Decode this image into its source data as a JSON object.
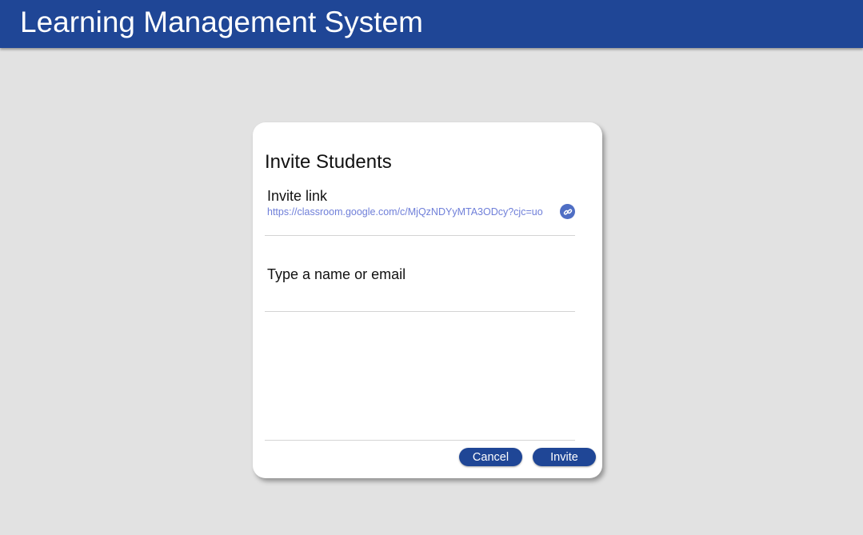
{
  "header": {
    "title": "Learning Management System"
  },
  "dialog": {
    "title": "Invite Students",
    "invite_link": {
      "label": "Invite link",
      "url": "https://classroom.google.com/c/MjQzNDYyMTA3ODcy?cjc=uo",
      "copy_icon": "link-icon"
    },
    "invitee_input": {
      "placeholder": "Type a name or email",
      "value": ""
    },
    "buttons": {
      "cancel_label": "Cancel",
      "invite_label": "Invite"
    }
  },
  "colors": {
    "brand": "#1f4696",
    "link": "#6f7fd9",
    "background": "#e2e2e2"
  }
}
